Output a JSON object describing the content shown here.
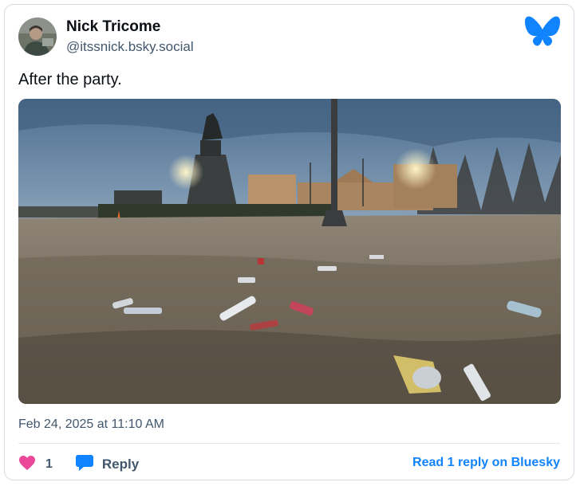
{
  "post": {
    "author_name": "Nick Tricome",
    "author_handle": "@itssnick.bsky.social",
    "text": "After the party.",
    "timestamp": "Feb 24, 2025 at 11:10 AM",
    "like_count": "1",
    "reply_label": "Reply",
    "read_replies_link": "Read 1 reply on Bluesky"
  },
  "icons": {
    "logo": "butterfly-icon",
    "like": "heart-icon",
    "reply": "speech-bubble-icon"
  },
  "colors": {
    "brand_blue": "#1083fe",
    "like_pink": "#ec4899",
    "text_primary": "#0b0f14",
    "text_secondary": "#42576c"
  }
}
